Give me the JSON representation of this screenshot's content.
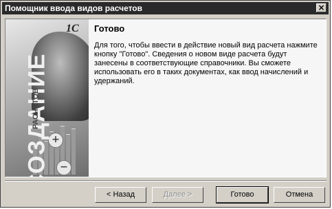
{
  "window": {
    "title": "Помощник ввода видов расчетов"
  },
  "side": {
    "big_vertical": "СОЗДАНИЕ",
    "small_vertical": "РАСЧЕТОВ",
    "plus_symbol": "+",
    "minus_symbol": "−"
  },
  "logo": "1С",
  "main": {
    "heading": "Готово",
    "message": "Для того, чтобы ввести в действие новый вид расчета нажмите кнопку \"Готово\". Сведения о новом виде расчета будут занесены в соответствующие справочники. Вы сможете использовать его в таких документах, как ввод начислений и удержаний."
  },
  "buttons": {
    "back": "< Назад",
    "next": "Далее >",
    "finish": "Готово",
    "cancel": "Отмена"
  },
  "controls": {
    "close_symbol": "×"
  }
}
